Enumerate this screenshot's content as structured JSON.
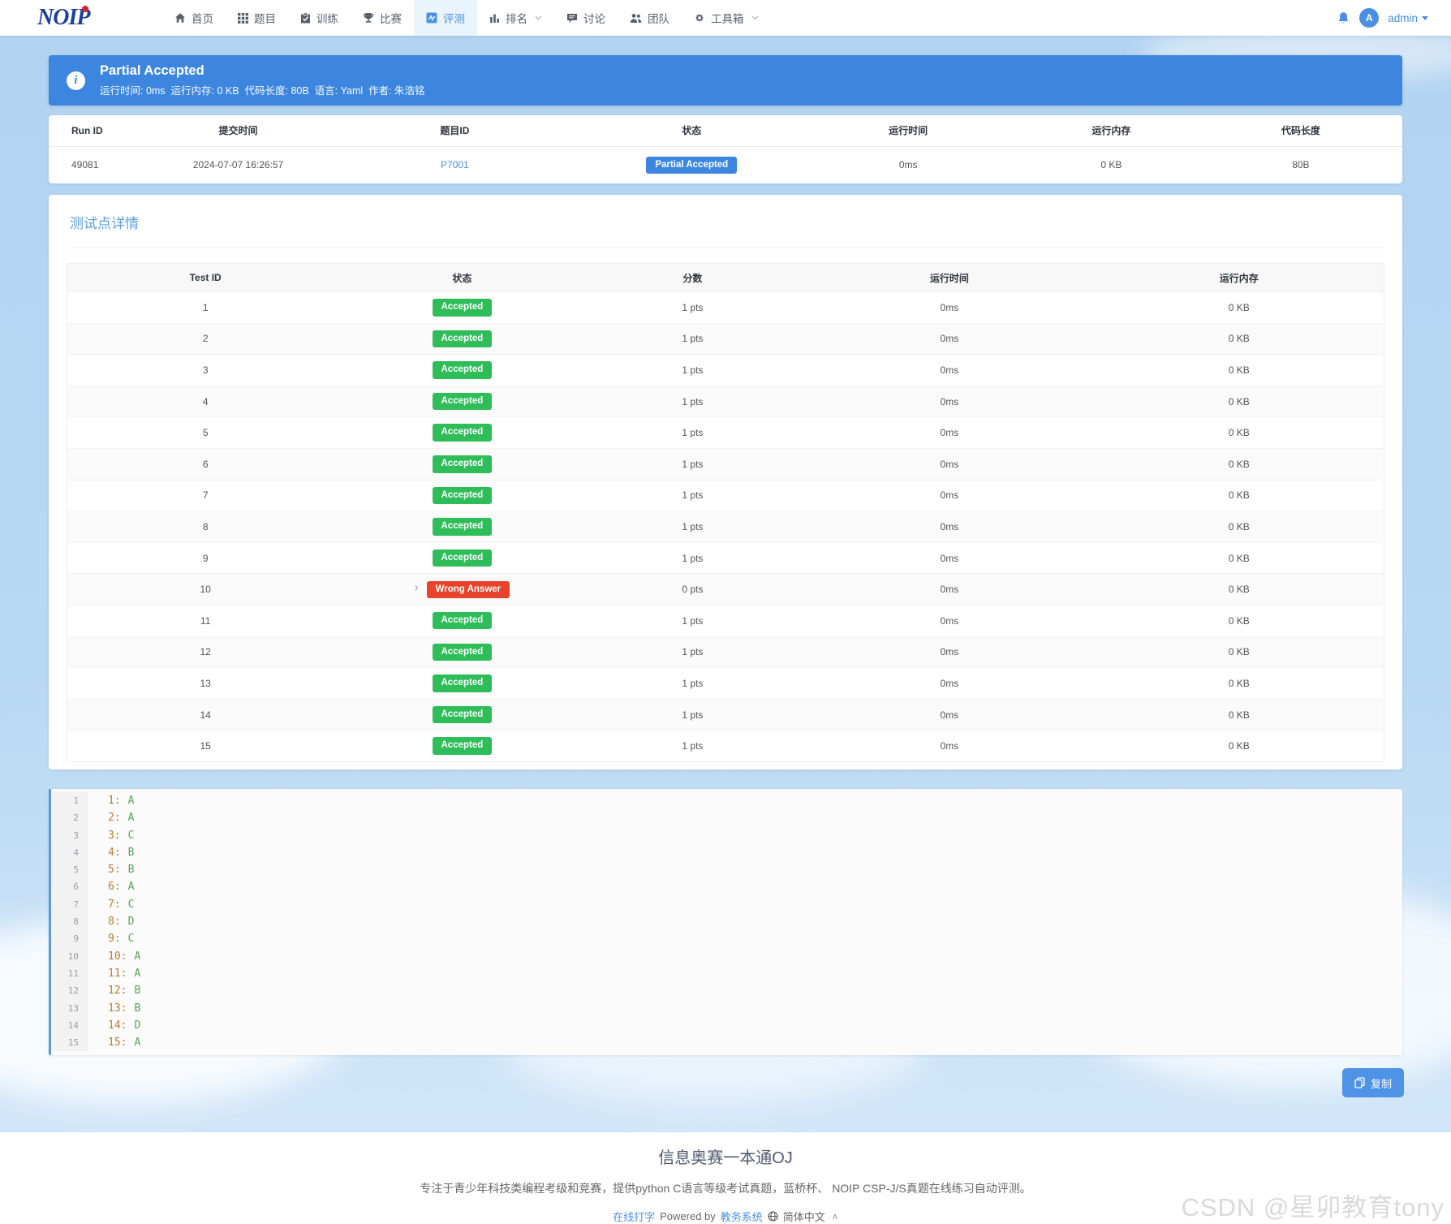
{
  "navbar": {
    "logo_text": "NOIP",
    "items": [
      {
        "label": "首页"
      },
      {
        "label": "题目"
      },
      {
        "label": "训练"
      },
      {
        "label": "比赛"
      },
      {
        "label": "评测"
      },
      {
        "label": "排名"
      },
      {
        "label": "讨论"
      },
      {
        "label": "团队"
      },
      {
        "label": "工具箱"
      }
    ],
    "avatar_letter": "A",
    "user_name": "admin"
  },
  "banner": {
    "title": "Partial Accepted",
    "meta": "运行时间: 0ms  运行内存: 0 KB  代码长度: 80B  语言: Yaml  作者: 朱浩铭"
  },
  "run_table": {
    "headers": [
      "Run ID",
      "提交时间",
      "题目ID",
      "状态",
      "运行时间",
      "运行内存",
      "代码长度"
    ],
    "row": {
      "run_id": "49081",
      "submit_time": "2024-07-07 16:26:57",
      "problem_id": "P7001",
      "status": "Partial Accepted",
      "time": "0ms",
      "memory": "0 KB",
      "length": "80B"
    }
  },
  "tests": {
    "section_title": "测试点详情",
    "headers": [
      "Test ID",
      "状态",
      "分数",
      "运行时间",
      "运行内存"
    ],
    "expand_icon": "›",
    "rows": [
      {
        "id": "1",
        "status": "Accepted",
        "score": "1 pts",
        "time": "0ms",
        "memory": "0 KB"
      },
      {
        "id": "2",
        "status": "Accepted",
        "score": "1 pts",
        "time": "0ms",
        "memory": "0 KB"
      },
      {
        "id": "3",
        "status": "Accepted",
        "score": "1 pts",
        "time": "0ms",
        "memory": "0 KB"
      },
      {
        "id": "4",
        "status": "Accepted",
        "score": "1 pts",
        "time": "0ms",
        "memory": "0 KB"
      },
      {
        "id": "5",
        "status": "Accepted",
        "score": "1 pts",
        "time": "0ms",
        "memory": "0 KB"
      },
      {
        "id": "6",
        "status": "Accepted",
        "score": "1 pts",
        "time": "0ms",
        "memory": "0 KB"
      },
      {
        "id": "7",
        "status": "Accepted",
        "score": "1 pts",
        "time": "0ms",
        "memory": "0 KB"
      },
      {
        "id": "8",
        "status": "Accepted",
        "score": "1 pts",
        "time": "0ms",
        "memory": "0 KB"
      },
      {
        "id": "9",
        "status": "Accepted",
        "score": "1 pts",
        "time": "0ms",
        "memory": "0 KB"
      },
      {
        "id": "10",
        "status": "Wrong Answer",
        "score": "0 pts",
        "time": "0ms",
        "memory": "0 KB"
      },
      {
        "id": "11",
        "status": "Accepted",
        "score": "1 pts",
        "time": "0ms",
        "memory": "0 KB"
      },
      {
        "id": "12",
        "status": "Accepted",
        "score": "1 pts",
        "time": "0ms",
        "memory": "0 KB"
      },
      {
        "id": "13",
        "status": "Accepted",
        "score": "1 pts",
        "time": "0ms",
        "memory": "0 KB"
      },
      {
        "id": "14",
        "status": "Accepted",
        "score": "1 pts",
        "time": "0ms",
        "memory": "0 KB"
      },
      {
        "id": "15",
        "status": "Accepted",
        "score": "1 pts",
        "time": "0ms",
        "memory": "0 KB"
      }
    ]
  },
  "code": {
    "copy_label": "复制",
    "lines": [
      {
        "no": "1",
        "k": "1:",
        "v": "A"
      },
      {
        "no": "2",
        "k": "2:",
        "v": "A"
      },
      {
        "no": "3",
        "k": "3:",
        "v": "C"
      },
      {
        "no": "4",
        "k": "4:",
        "v": "B"
      },
      {
        "no": "5",
        "k": "5:",
        "v": "B"
      },
      {
        "no": "6",
        "k": "6:",
        "v": "A"
      },
      {
        "no": "7",
        "k": "7:",
        "v": "C"
      },
      {
        "no": "8",
        "k": "8:",
        "v": "D"
      },
      {
        "no": "9",
        "k": "9:",
        "v": "C"
      },
      {
        "no": "10",
        "k": "10:",
        "v": "A"
      },
      {
        "no": "11",
        "k": "11:",
        "v": "A"
      },
      {
        "no": "12",
        "k": "12:",
        "v": "B"
      },
      {
        "no": "13",
        "k": "13:",
        "v": "B"
      },
      {
        "no": "14",
        "k": "14:",
        "v": "D"
      },
      {
        "no": "15",
        "k": "15:",
        "v": "A"
      }
    ]
  },
  "footer": {
    "title": "信息奥赛一本通OJ",
    "description": "专注于青少年科技类编程考级和竞赛，提供python C语言等级考试真题，蓝桥杯、 NOIP CSP-J/S真题在线练习自动评测。",
    "link_typing": "在线打字",
    "powered_by": "Powered by",
    "link_system": "教务系统",
    "lang": "简体中文",
    "caret": "∧"
  },
  "watermark": "CSDN @星卯教育tony"
}
